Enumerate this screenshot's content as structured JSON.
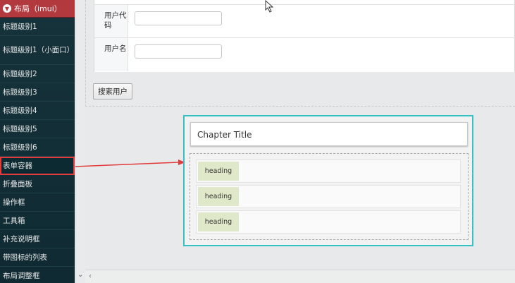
{
  "sidebar": {
    "header": "布局（imui）",
    "items": [
      {
        "label": "标题级别1"
      },
      {
        "label": "标题级别1（小面口）"
      },
      {
        "label": "标题级别2"
      },
      {
        "label": "标题级别3"
      },
      {
        "label": "标题级别4"
      },
      {
        "label": "标题级别5"
      },
      {
        "label": "标题级别6"
      },
      {
        "label": "表单容器"
      },
      {
        "label": "折叠面板"
      },
      {
        "label": "操作框"
      },
      {
        "label": "工具箱"
      },
      {
        "label": "补充说明框"
      },
      {
        "label": "带图标的列表"
      },
      {
        "label": "布局调整框"
      }
    ],
    "highlight_color": "#e23b3b"
  },
  "form": {
    "user_code_label": "用户代码",
    "user_name_label": "用户名",
    "user_code_value": "",
    "user_name_value": "",
    "search_label": "搜索用户"
  },
  "demo": {
    "chapter_title": "Chapter Title",
    "rows": [
      {
        "heading": "heading"
      },
      {
        "heading": "heading"
      },
      {
        "heading": "heading"
      }
    ],
    "accent_color": "#36c0c0"
  },
  "arrow_color": "#e23b3b"
}
